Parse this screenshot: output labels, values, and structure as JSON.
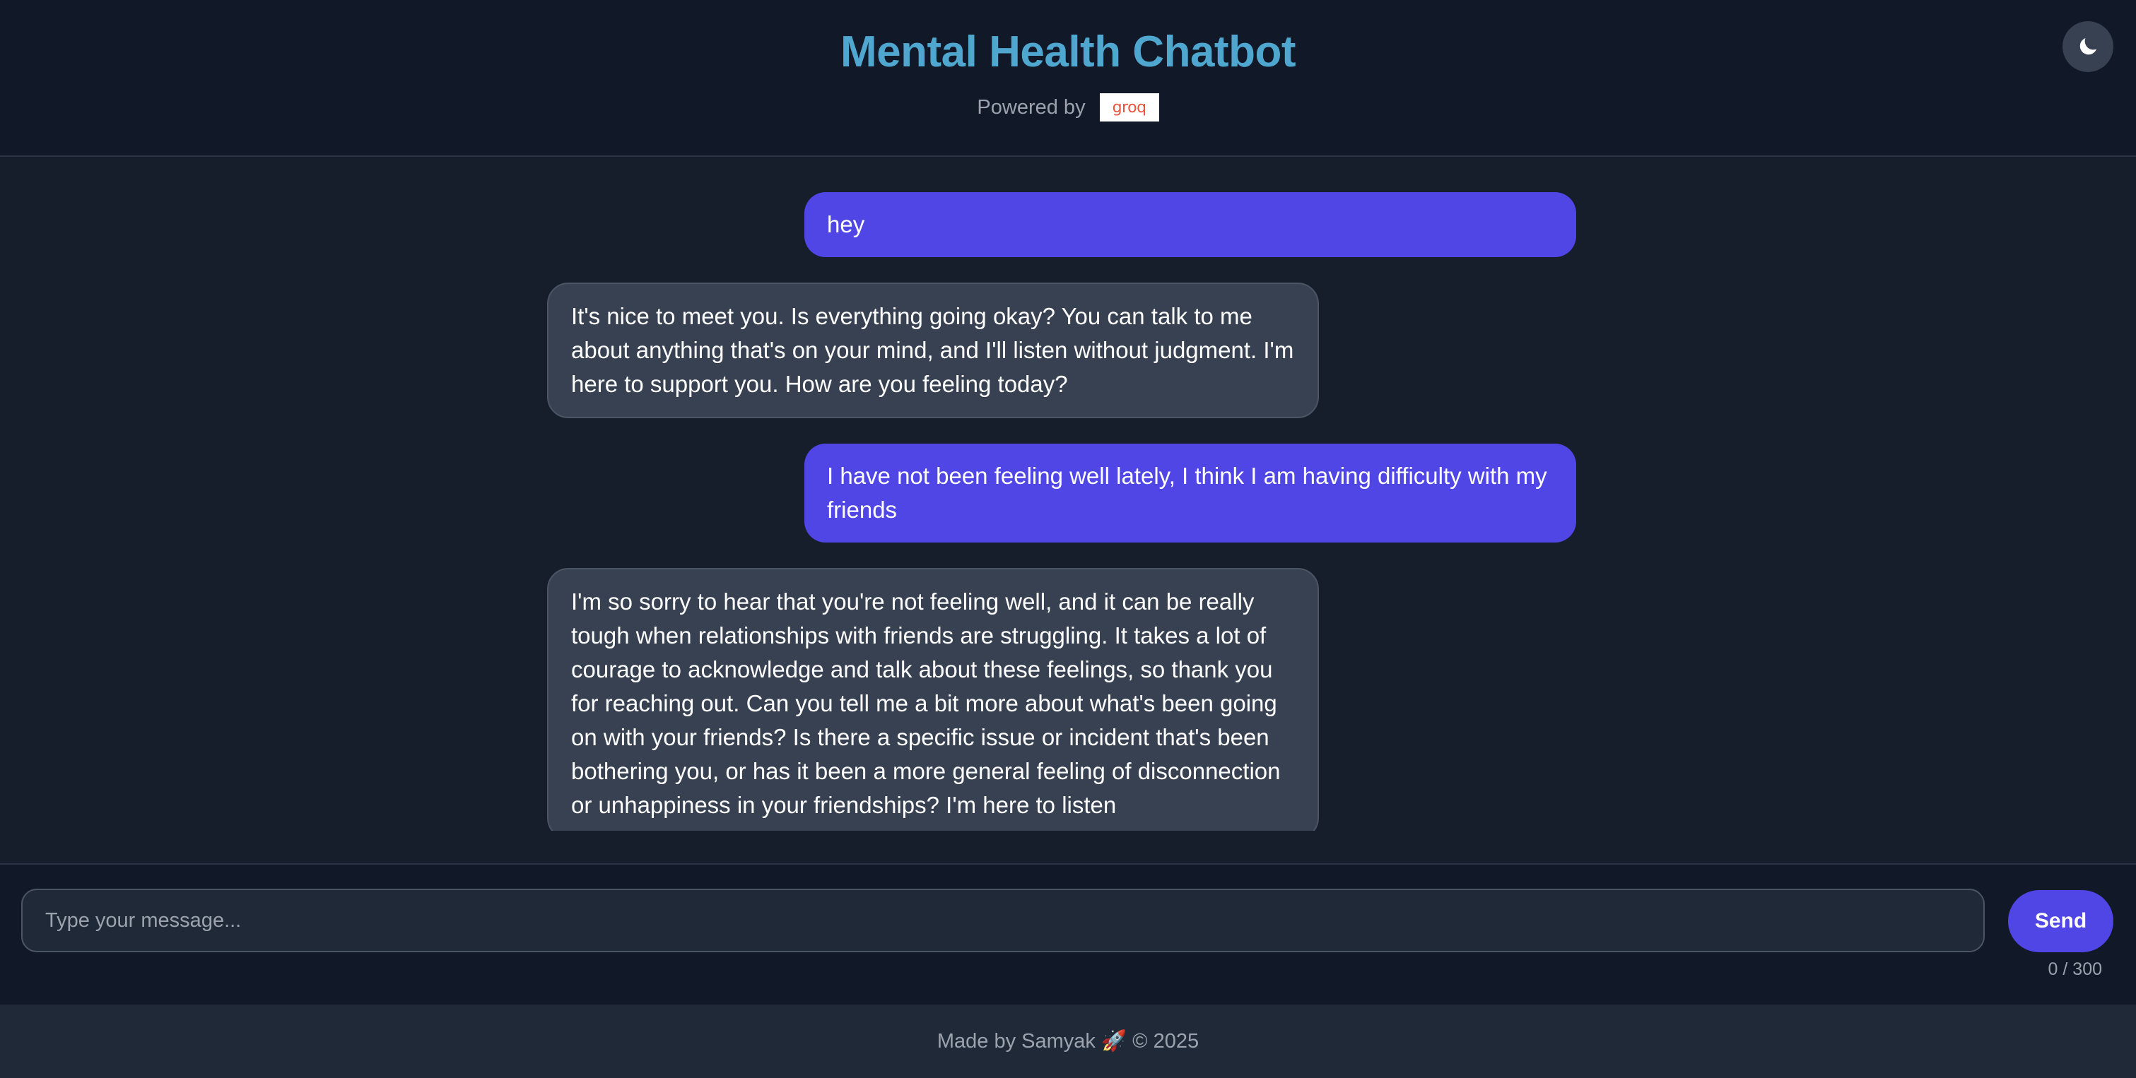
{
  "header": {
    "title": "Mental Health Chatbot",
    "powered_by": "Powered by",
    "groq_logo_text": "groq",
    "theme_icon": "moon-icon"
  },
  "messages": [
    {
      "role": "user",
      "text": "hey"
    },
    {
      "role": "bot",
      "text": "It's nice to meet you. Is everything going okay? You can talk to me about anything that's on your mind, and I'll listen without judgment. I'm here to support you. How are you feeling today?"
    },
    {
      "role": "user",
      "text": "I have not been feeling well lately, I think I am having difficulty with my friends"
    },
    {
      "role": "bot",
      "text": "I'm so sorry to hear that you're not feeling well, and it can be really tough when relationships with friends are struggling. It takes a lot of courage to acknowledge and talk about these feelings, so thank you for reaching out. Can you tell me a bit more about what's been going on with your friends? Is there a specific issue or incident that's been bothering you, or has it been a more general feeling of disconnection or unhappiness in your friendships? I'm here to listen"
    }
  ],
  "composer": {
    "placeholder": "Type your message...",
    "value": "",
    "send_label": "Send",
    "char_count": "0 / 300"
  },
  "footer": {
    "text": "Made by Samyak 🚀 © 2025"
  },
  "colors": {
    "accent": "#4f46e5",
    "title": "#4fa7cf",
    "bot_bubble": "#374151",
    "background": "#111827"
  }
}
